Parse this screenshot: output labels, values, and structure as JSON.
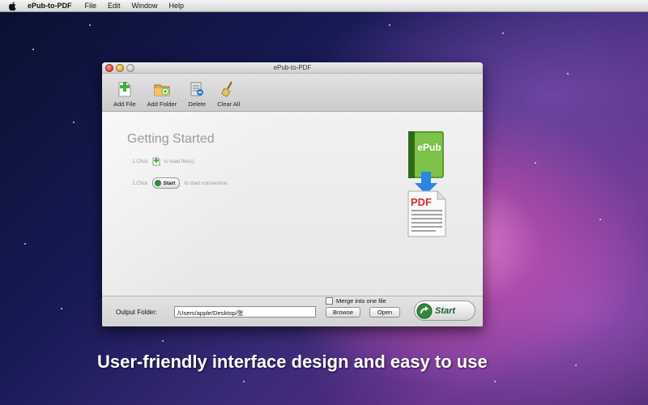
{
  "menubar": {
    "apple_icon": "apple-icon",
    "app_name": "ePub-to-PDF",
    "items": [
      "File",
      "Edit",
      "Window",
      "Help"
    ]
  },
  "window": {
    "title": "ePub-to-PDF"
  },
  "toolbar": {
    "add_file": "Add File",
    "add_folder": "Add Folder",
    "delete": "Delete",
    "clear_all": "Clear All"
  },
  "main": {
    "heading": "Getting Started",
    "step1_prefix": "1.Click",
    "step1_suffix": "to load file(s).",
    "step2_prefix": "2.Click",
    "step2_button": "Start",
    "step2_suffix": "to start conversion.",
    "book_label": "ePub",
    "pdf_label": "PDF"
  },
  "bottom": {
    "output_label": "Output Folder:",
    "output_value": "/Users/apple/Desktop/张",
    "browse": "Browse",
    "open": "Open",
    "merge_label": "Merge into one file",
    "merge_checked": false,
    "start": "Start"
  },
  "caption": "User-friendly interface design and easy to use",
  "colors": {
    "accent_green": "#2e8b3a",
    "pdf_red": "#d62a2a",
    "arrow_blue": "#1f74d6"
  }
}
